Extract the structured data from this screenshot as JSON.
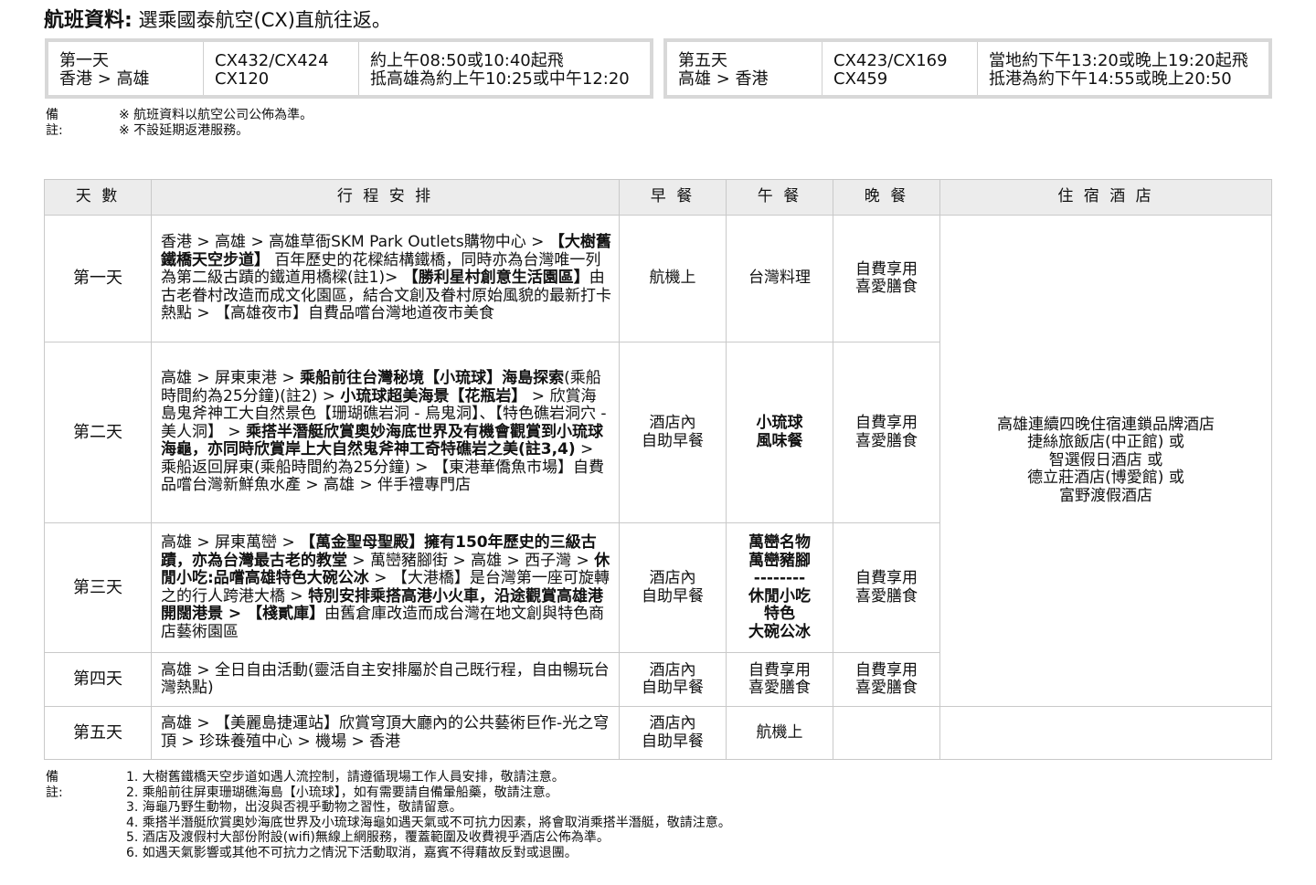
{
  "header": {
    "title_label": "航班資料:",
    "title_text": "選乘國泰航空(CX)直航往返。"
  },
  "flights": [
    {
      "day": "第一天",
      "route": "香港 > 高雄",
      "flight_line1": "CX432/CX424",
      "flight_line2": "CX120",
      "time_line1": "約上午08:50或10:40起飛",
      "time_line2": "抵高雄為約上午10:25或中午12:20"
    },
    {
      "day": "第五天",
      "route": "高雄 > 香港",
      "flight_line1": "CX423/CX169",
      "flight_line2": "CX459",
      "time_line1": "當地約下午13:20或晚上19:20起飛",
      "time_line2": "抵港為約下午14:55或晚上20:50"
    }
  ],
  "flight_notes": {
    "label": "備註:",
    "items": [
      "※ 航班資料以航空公司公佈為準。",
      "※ 不設延期返港服務。"
    ]
  },
  "table": {
    "headers": [
      "天 數",
      "行 程 安 排",
      "早 餐",
      "午 餐",
      "晚 餐",
      "住 宿 酒 店"
    ],
    "hotel": [
      "高雄連續四晚住宿連鎖品牌酒店",
      "捷絲旅飯店(中正館) 或",
      "智選假日酒店 或",
      "德立莊酒店(博愛館) 或",
      "富野渡假酒店"
    ],
    "rows": [
      {
        "day": "第一天",
        "route": [
          {
            "t": "香港 > 高雄 > 高雄草衙SKM Park Outlets購物中心 > "
          },
          {
            "t": "【大樹舊鐵橋天空步道】",
            "b": true
          },
          {
            "t": " 百年歷史的花樑結構鐵橋，同時亦為台灣唯一列為第二級古蹟的鐵道用橋樑(註1)> "
          },
          {
            "t": "【勝利星村創意生活園區】",
            "b": true
          },
          {
            "t": "由古老眷村改造而成文化園區，結合文創及眷村原始風貌的最新打卡熱點 > 【高雄夜市】自費品嚐台灣地道夜市美食"
          }
        ],
        "breakfast": [
          "航機上"
        ],
        "lunch": [
          "台灣料理"
        ],
        "lunch_bold": false,
        "dinner": [
          "自費享用",
          "喜愛膳食"
        ]
      },
      {
        "day": "第二天",
        "route": [
          {
            "t": "高雄 > 屏東東港 > "
          },
          {
            "t": "乘船前往台灣秘境【小琉球】海島探索",
            "b": true
          },
          {
            "t": "(乘船時間約為25分鐘)(註2) > "
          },
          {
            "t": "小琉球超美海景【花瓶岩】",
            "b": true
          },
          {
            "t": " > 欣賞海島鬼斧神工大自然景色【珊瑚礁岩洞 - 烏鬼洞】、【特色礁岩洞穴 - 美人洞】 > "
          },
          {
            "t": "乘搭半潛艇欣賞奧妙海底世界及有機會觀賞到小琉球海龜，亦同時欣賞岸上大自然鬼斧神工奇特礁岩之美(註3,4)",
            "b": true
          },
          {
            "t": " > 乘船返回屏東(乘船時間約為25分鐘) > 【東港華僑魚市場】自費品嚐台灣新鮮魚水產 > 高雄 > 伴手禮專門店"
          }
        ],
        "breakfast": [
          "酒店內",
          "自助早餐"
        ],
        "lunch": [
          "小琉球",
          "風味餐"
        ],
        "lunch_bold": true,
        "dinner": [
          "自費享用",
          "喜愛膳食"
        ]
      },
      {
        "day": "第三天",
        "route": [
          {
            "t": "高雄 > 屏東萬巒 > "
          },
          {
            "t": "【萬金聖母聖殿】擁有150年歷史的三級古蹟，亦為台灣最古老的教堂",
            "b": true
          },
          {
            "t": " > 萬巒豬腳街 > 高雄 > 西子灣 > "
          },
          {
            "t": "休閒小吃:品嚐高雄特色大碗公冰",
            "b": true
          },
          {
            "t": " > 【大港橋】是台灣第一座可旋轉之的行人跨港大橋 > "
          },
          {
            "t": "特別安排乘搭高港小火車，沿途觀賞高雄港開闊港景 > 【棧貳庫】",
            "b": true
          },
          {
            "t": "由舊倉庫改造而成台灣在地文創與特色商店藝術園區"
          }
        ],
        "breakfast": [
          "酒店內",
          "自助早餐"
        ],
        "lunch": [
          "萬巒名物",
          "萬巒豬腳",
          "--------",
          "休閒小吃",
          "特色",
          "大碗公冰"
        ],
        "lunch_bold": true,
        "dinner": [
          "自費享用",
          "喜愛膳食"
        ]
      },
      {
        "day": "第四天",
        "route": [
          {
            "t": "高雄 > 全日自由活動(靈活自主安排屬於自己既行程，自由暢玩台灣熱點)"
          }
        ],
        "breakfast": [
          "酒店內",
          "自助早餐"
        ],
        "lunch": [
          "自費享用",
          "喜愛膳食"
        ],
        "lunch_bold": false,
        "dinner": [
          "自費享用",
          "喜愛膳食"
        ]
      },
      {
        "day": "第五天",
        "route": [
          {
            "t": "高雄 > 【美麗島捷運站】欣賞穹頂大廳內的公共藝術巨作-光之穹頂 > 珍珠養殖中心 > 機場 > 香港"
          }
        ],
        "breakfast": [
          "酒店內",
          "自助早餐"
        ],
        "lunch": [
          "航機上"
        ],
        "lunch_bold": false,
        "dinner": []
      }
    ]
  },
  "footer_notes": {
    "label": "備註:",
    "items": [
      "1. 大樹舊鐵橋天空步道如遇人流控制，請遵循現場工作人員安排，敬請注意。",
      "2. 乘船前往屏東珊瑚礁海島【小琉球】，如有需要請自備暈船藥，敬請注意。",
      "3. 海龜乃野生動物，出沒與否視乎動物之習性，敬請留意。",
      "4. 乘搭半潛艇欣賞奧妙海底世界及小琉球海龜如遇天氣或不可抗力因素，將會取消乘搭半潛艇，敬請注意。",
      "5. 酒店及渡假村大部份附設(wifi)無線上網服務，覆蓋範圍及收費視乎酒店公佈為準。",
      "6. 如遇天氣影響或其他不可抗力之情況下活動取消，嘉賓不得藉故反對或退團。"
    ]
  }
}
